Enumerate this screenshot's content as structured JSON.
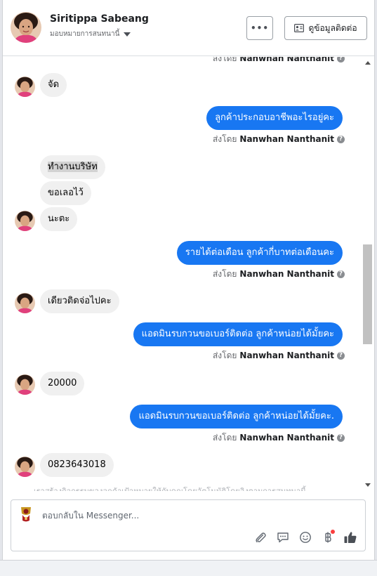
{
  "contact": {
    "name": "Siritippa Sabeang",
    "assign_label": "มอบหมายการสนทนานี้"
  },
  "header": {
    "more_label": "•••",
    "contact_info_label": "ดูข้อมูลติดต่อ"
  },
  "sent_by_prefix": "ส่งโดย",
  "agent_name": "Nanwhan Nanthanit",
  "messages": [
    {
      "dir": "in",
      "text": "จัด"
    },
    {
      "dir": "out",
      "text": "ลูกค้าประกอบอาชีพอะไรอยู่คะ"
    },
    {
      "dir": "in",
      "text": "ทำงานบริษัท"
    },
    {
      "dir": "in",
      "text": "ขอเลอไว้"
    },
    {
      "dir": "in",
      "text": "นะตะ"
    },
    {
      "dir": "out",
      "text": "รายได้ต่อเดือน ลูกค้ากี่บาทต่อเดือนคะ"
    },
    {
      "dir": "in",
      "text": "เดียวติดจ่อไปคะ"
    },
    {
      "dir": "out",
      "text": "แอดมินรบกวนขอเบอร์ติดต่อ ลูกค้าหน่อยได้มั้ยคะ"
    },
    {
      "dir": "in",
      "text": "20000"
    },
    {
      "dir": "out",
      "text": "แอดมินรบกวนขอเบอร์ติดต่อ ลูกค้าหน่อยได้มั้ยคะ."
    },
    {
      "dir": "in",
      "text": "0823643018"
    }
  ],
  "faded_notice": "เราสร้างกิจกรรมของลูกค้าเป้าหมายให้กับคุณโดยอัตโนมัติโดยอิงตามการสนทนานี้",
  "composer": {
    "placeholder": "ตอบกลับใน Messenger..."
  },
  "icons": {
    "attach": "paperclip-icon",
    "saved_replies": "chat-bubble-icon",
    "emoji": "smiley-icon",
    "payment": "baht-icon",
    "like": "thumbs-up-icon"
  },
  "colors": {
    "outgoing_bubble": "#1877f2",
    "incoming_bubble": "#f0f0f0",
    "notification_dot": "#fa3e3e"
  }
}
